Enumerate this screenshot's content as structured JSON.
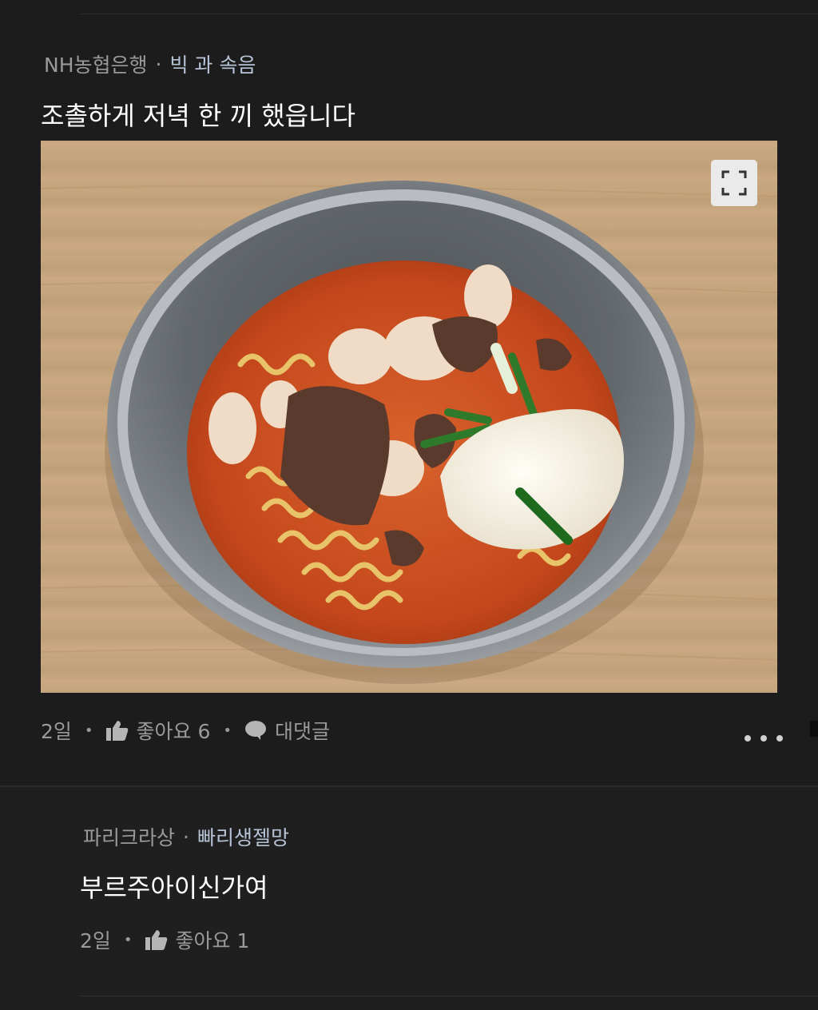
{
  "post": {
    "author": "NH농협은행",
    "separator": "·",
    "author_title": "빅 과 속음",
    "title": "조촐하게 저녁 한 끼 했읍니다",
    "image_icon": "expand-icon",
    "age": "2일",
    "like_label": "좋아요 6",
    "reply_label": "대댓글",
    "more_icon": "more-dots-icon"
  },
  "reply": {
    "author": "파리크라상",
    "separator": "·",
    "author_title": "빠리생젤망",
    "text": "부르주아이신가여",
    "age": "2일",
    "like_label": "좋아요 1"
  },
  "colors": {
    "background": "#1c1c1c",
    "reply_background": "#1f1f1f",
    "text_primary": "#ffffff",
    "text_secondary": "#9a9a9a",
    "badge": "#b7c3d6"
  }
}
